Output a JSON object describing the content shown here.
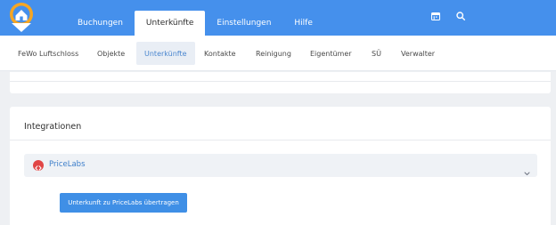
{
  "colors": {
    "brand_blue": "#4590ec",
    "logo_orange": "#f5a623",
    "accent_blue": "#3e7fca",
    "button_blue": "#3f8fe6",
    "integration_red": "#e14646"
  },
  "header": {
    "logo_icon": "house-pin-logo-icon",
    "tabs": [
      {
        "label": "Buchungen",
        "active": false
      },
      {
        "label": "Unterkünfte",
        "active": true
      },
      {
        "label": "Einstellungen",
        "active": false
      },
      {
        "label": "Hilfe",
        "active": false
      }
    ],
    "icons": [
      "calendar-icon",
      "search-icon"
    ]
  },
  "subnav": {
    "items": [
      {
        "label": "FeWo Luftschloss",
        "active": false
      },
      {
        "label": "Objekte",
        "active": false
      },
      {
        "label": "Unterkünfte",
        "active": true
      },
      {
        "label": "Kontakte",
        "active": false
      },
      {
        "label": "Reinigung",
        "active": false
      },
      {
        "label": "Eigentümer",
        "active": false
      },
      {
        "label": "SÜ",
        "active": false
      },
      {
        "label": "Verwalter",
        "active": false
      }
    ]
  },
  "integrations": {
    "title": "Integrationen",
    "accordion": {
      "icon": "pricelabs-code-icon",
      "label": "PriceLabs",
      "expanded": true,
      "chevron_icon": "chevron-down-icon"
    },
    "transfer_button_label": "Unterkunft zu PriceLabs übertragen"
  }
}
